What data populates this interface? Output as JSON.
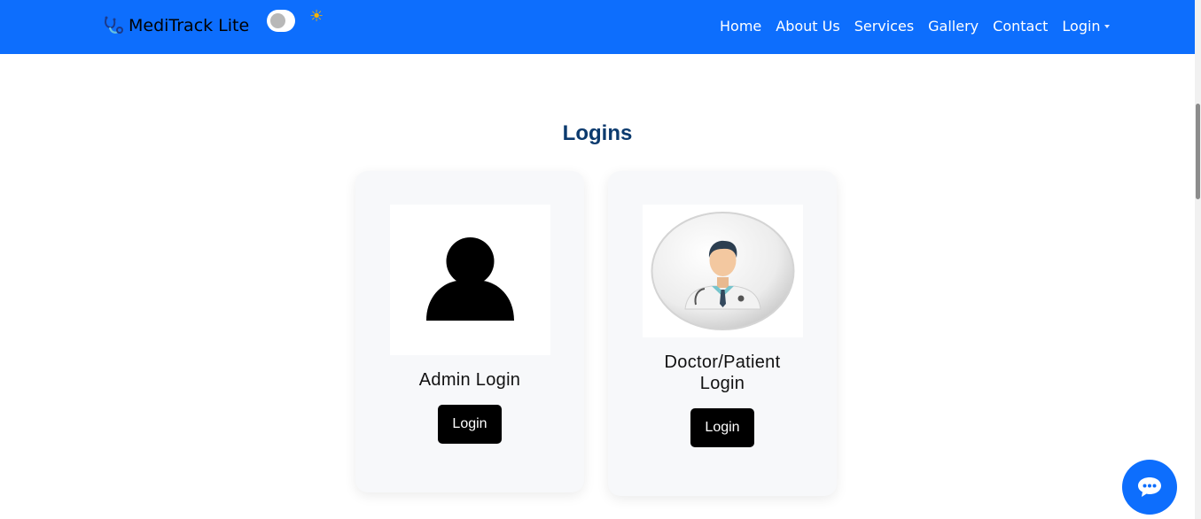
{
  "navbar": {
    "brand": "MediTrack Lite",
    "links": [
      "Home",
      "About Us",
      "Services",
      "Gallery",
      "Contact"
    ],
    "login_label": "Login",
    "theme_icon": "sun-icon",
    "colors": {
      "bg": "#0d6efd",
      "text": "#ffffff"
    }
  },
  "main": {
    "title": "Logins",
    "cards": [
      {
        "label": "Admin Login",
        "button": "Login",
        "image": "admin-avatar"
      },
      {
        "label": "Doctor/Patient Login",
        "button": "Login",
        "image": "doctor-avatar"
      }
    ]
  },
  "chat": {
    "icon": "chat-bubble-icon"
  },
  "colors": {
    "title": "#0b3a6e",
    "card_bg": "#f7f8fa",
    "button_bg": "#000000"
  }
}
